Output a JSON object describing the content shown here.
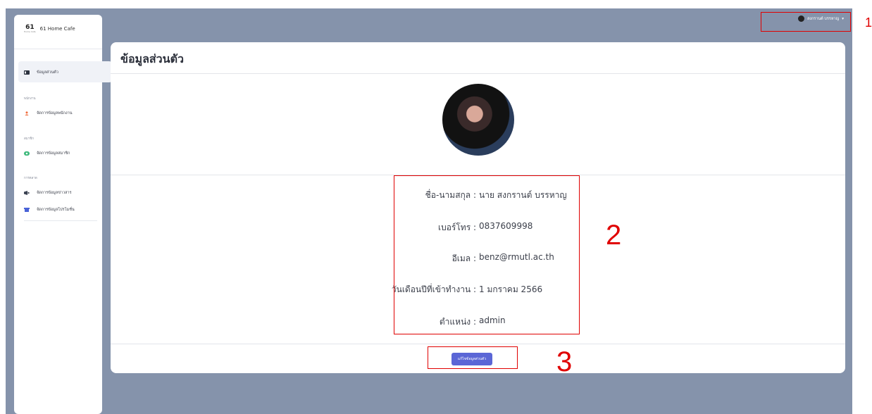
{
  "brand": {
    "logo_text": "61",
    "logo_sub": "Home Cafe",
    "name": "61 Home Cafe"
  },
  "sidebar": {
    "items": [
      {
        "label": "ข้อมูลส่วนตัว",
        "icon": "id-card-icon",
        "color": "#2d3340"
      },
      {
        "section": "พนักงาน"
      },
      {
        "label": "จัดการข้อมูลพนักงาน",
        "icon": "user-icon",
        "color": "#f06a3a"
      },
      {
        "section": "สมาชิก"
      },
      {
        "label": "จัดการข้อมูลสมาชิก",
        "icon": "members-icon",
        "color": "#3cb87a"
      },
      {
        "section": "การตลาด"
      },
      {
        "label": "จัดการข้อมูลข่าวสาร",
        "icon": "megaphone-icon",
        "color": "#3b4252"
      },
      {
        "label": "จัดการข้อมูลโปรโมชั่น",
        "icon": "store-icon",
        "color": "#4a63d8"
      }
    ]
  },
  "header": {
    "user_name": "สงกรานต์ บรรหาญ",
    "dropdown_icon": "chevron-down-icon"
  },
  "card": {
    "title": "ข้อมูลส่วนตัว",
    "fields": [
      {
        "label": "ชื่อ-นามสกุล :",
        "value": "นาย สงกรานต์ บรรหาญ"
      },
      {
        "label": "เบอร์โทร :",
        "value": "0837609998"
      },
      {
        "label": "อีเมล :",
        "value": "benz@rmutl.ac.th"
      },
      {
        "label": "วันเดือนปีที่เข้าทำงาน :",
        "value": "1 มกราคม 2566"
      },
      {
        "label": "ตำแหน่ง :",
        "value": "admin"
      }
    ],
    "edit_button": "แก้ไขข้อมูลส่วนตัว"
  },
  "annotations": {
    "one": "1",
    "two": "2",
    "three": "3"
  },
  "colors": {
    "background": "#8593ab",
    "accent": "#5b66d6",
    "annotation": "#e00000"
  }
}
